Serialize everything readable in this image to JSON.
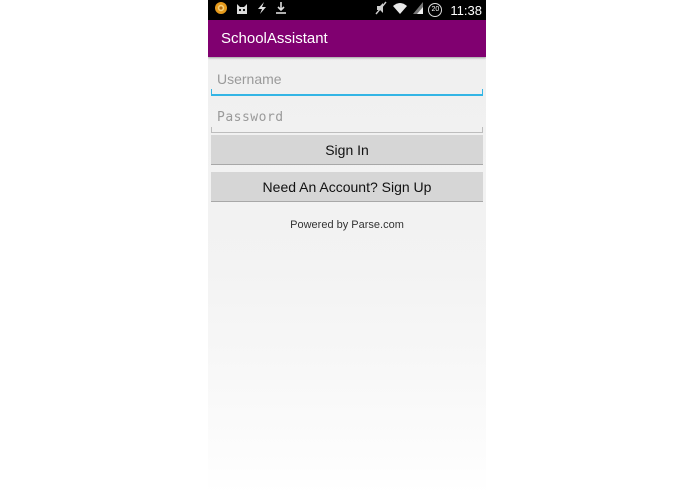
{
  "status_bar": {
    "time": "11:38",
    "battery_level": "20",
    "icons": [
      "orange-circle-app-icon",
      "cat-face-icon",
      "lightning-icon",
      "download-icon",
      "mute-icon",
      "wifi-icon",
      "signal-icon"
    ]
  },
  "app": {
    "title": "SchoolAssistant",
    "accent_color": "#800070",
    "focus_color": "#33b5e5"
  },
  "form": {
    "username_placeholder": "Username",
    "username_value": "",
    "password_placeholder": "Password",
    "password_value": "",
    "signin_label": "Sign In",
    "signup_label": "Need An Account? Sign Up"
  },
  "footer": {
    "powered_by": "Powered by Parse.com"
  }
}
